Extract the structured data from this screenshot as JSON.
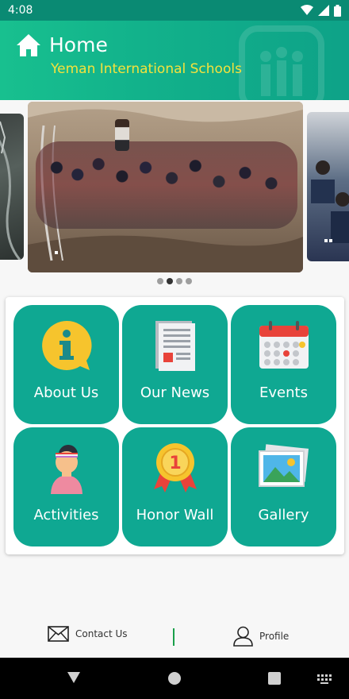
{
  "status_bar": {
    "time": "4:08"
  },
  "header": {
    "title": "Home",
    "subtitle": "Yeman International Schools"
  },
  "carousel": {
    "slide_count": 4,
    "active_index": 1
  },
  "menu": [
    {
      "label": "About Us",
      "icon": "info-icon"
    },
    {
      "label": "Our News",
      "icon": "news-document-icon"
    },
    {
      "label": "Events",
      "icon": "calendar-icon"
    },
    {
      "label": "Activities",
      "icon": "student-avatar-icon"
    },
    {
      "label": "Honor Wall",
      "icon": "medal-icon"
    },
    {
      "label": "Gallery",
      "icon": "gallery-image-icon"
    }
  ],
  "bottom_bar": {
    "contact_label": "Contact Us",
    "profile_label": "Profile"
  },
  "colors": {
    "accent": "#0fa892",
    "header_start": "#18c08f",
    "subtitle": "#f4e23c",
    "divider": "#1aa04a"
  }
}
